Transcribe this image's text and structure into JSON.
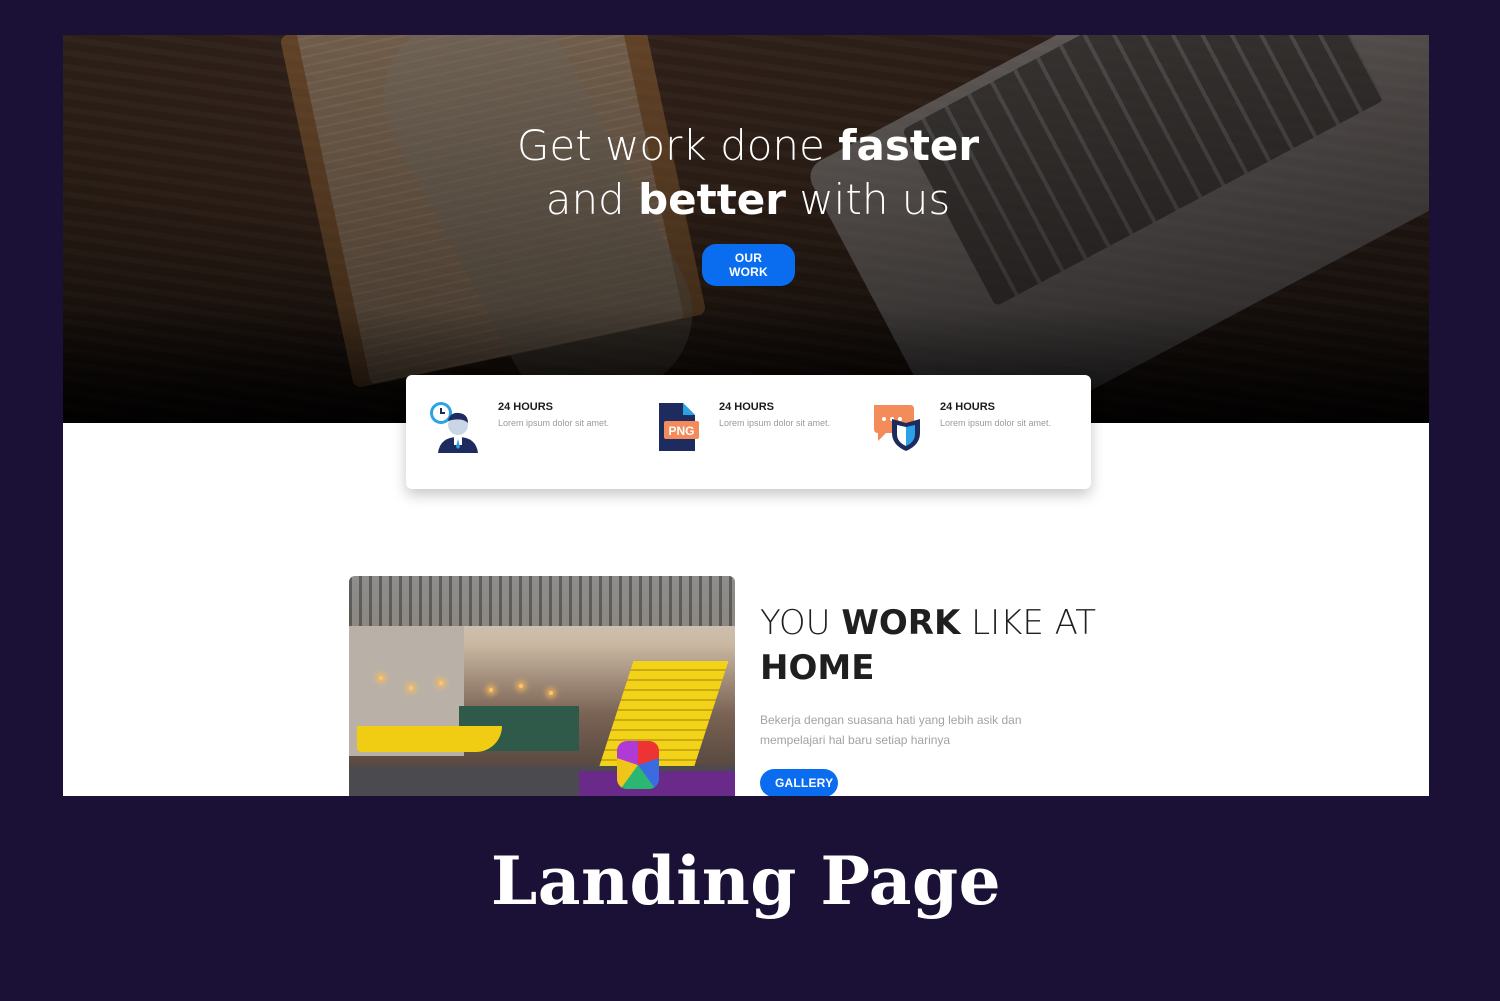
{
  "hero": {
    "title_line1_regular": "Get work done ",
    "title_line1_bold": "faster",
    "title_line2_regular_a": "and ",
    "title_line2_bold": "better",
    "title_line2_regular_b": " with us",
    "button_label": "OUR WORK"
  },
  "features": [
    {
      "title": "24 HOURS",
      "subtitle": "Lorem ipsum dolor sit amet.",
      "icon": "support-agent-icon"
    },
    {
      "title": "24 HOURS",
      "subtitle": "Lorem ipsum dolor sit amet.",
      "icon": "png-file-icon",
      "badge": "PNG"
    },
    {
      "title": "24 HOURS",
      "subtitle": "Lorem ipsum dolor sit amet.",
      "icon": "chat-shield-icon"
    }
  ],
  "about": {
    "title_a": "YOU ",
    "title_bold": "WORK",
    "title_b": " LIKE AT",
    "title_line2": "HOME",
    "text": "Bekerja dengan suasana hati yang lebih asik dan mempelajari hal baru setiap harinya",
    "button_label": "GALLERY"
  },
  "caption": "Landing Page",
  "colors": {
    "frame_bg": "#1b1035",
    "accent_blue": "#0a6df0",
    "feature_orange": "#f38b5a",
    "feature_navy": "#1e2b5e"
  }
}
